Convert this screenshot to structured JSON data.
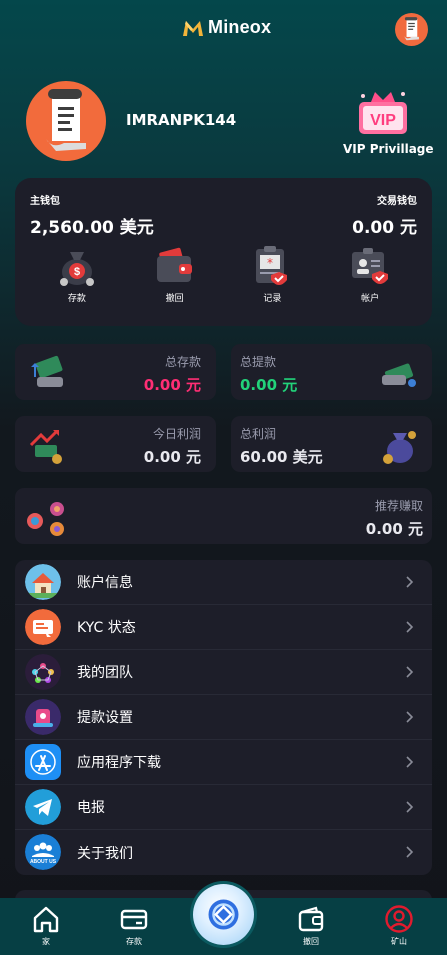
{
  "header": {
    "app_name": "Mineox",
    "logo_icon": "mineox-logo-icon",
    "avatar_icon": "scroll-avatar-icon"
  },
  "profile": {
    "username": "IMRANPK144",
    "avatar_icon": "scroll-avatar-icon",
    "vip_label": "VIP Privillage",
    "vip_badge_text": "VIP"
  },
  "wallet": {
    "main_label": "主钱包",
    "main_value": "2,560.00 美元",
    "trade_label": "交易钱包",
    "trade_value": "0.00 元",
    "actions": [
      {
        "label": "存款",
        "icon": "money-bag-icon"
      },
      {
        "label": "撤回",
        "icon": "wallet-icon"
      },
      {
        "label": "记录",
        "icon": "clipboard-icon"
      },
      {
        "label": "帐户",
        "icon": "id-card-icon"
      }
    ]
  },
  "stats": {
    "total_deposit": {
      "label": "总存款",
      "value": "0.00 元",
      "color": "#ff2e74"
    },
    "total_withdraw": {
      "label": "总提款",
      "value": "0.00 元",
      "color": "#22d37a"
    },
    "today_profit": {
      "label": "今日利润",
      "value": "0.00 元"
    },
    "total_profit": {
      "label": "总利润",
      "value": "60.00 美元"
    },
    "referral": {
      "label": "推荐赚取",
      "value": "0.00 元"
    }
  },
  "menu": [
    {
      "label": "账户信息",
      "icon": "house-icon"
    },
    {
      "label": "KYC 状态",
      "icon": "kyc-document-icon"
    },
    {
      "label": "我的团队",
      "icon": "team-icon"
    },
    {
      "label": "提款设置",
      "icon": "withdraw-settings-icon"
    },
    {
      "label": "应用程序下载",
      "icon": "app-store-icon"
    },
    {
      "label": "电报",
      "icon": "telegram-icon"
    },
    {
      "label": "关于我们",
      "icon": "about-us-icon"
    }
  ],
  "about_icon_text": "ABOUT US",
  "tabbar": [
    {
      "label": "家",
      "icon": "home-icon"
    },
    {
      "label": "存款",
      "icon": "card-icon"
    },
    {
      "label": "",
      "icon": "mining-center-icon"
    },
    {
      "label": "撤回",
      "icon": "wallet-icon"
    },
    {
      "label": "矿山",
      "icon": "user-circle-icon"
    }
  ],
  "colors": {
    "accent_pink": "#ff2e74",
    "accent_green": "#22d37a",
    "card_bg": "#1d1e29",
    "tab_bg": "#063f44"
  }
}
